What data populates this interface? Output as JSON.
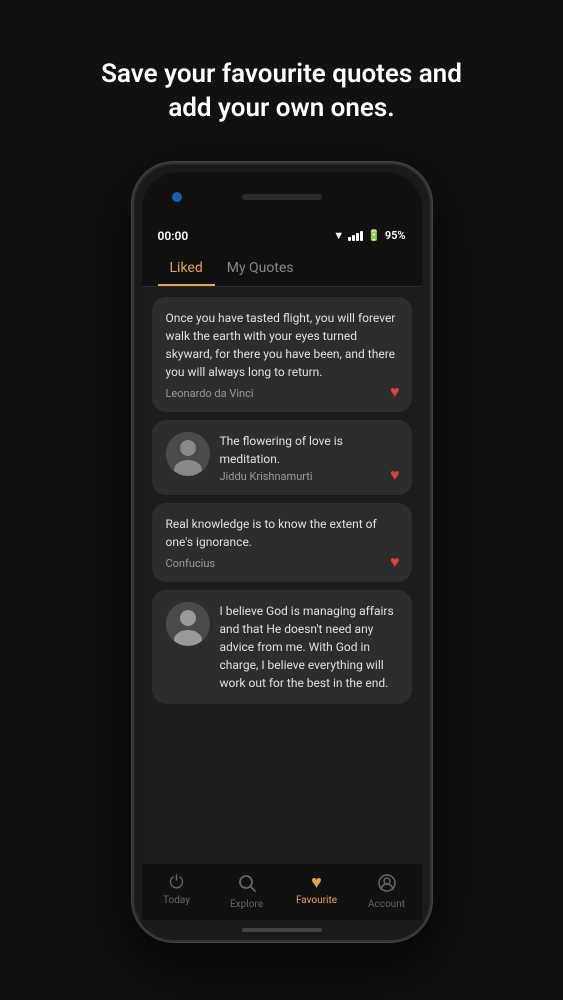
{
  "header": {
    "title": "Save your favourite quotes and add your own ones."
  },
  "status_bar": {
    "time": "00:00",
    "battery": "95%"
  },
  "tabs": {
    "items": [
      {
        "label": "Liked",
        "active": true
      },
      {
        "label": "My Quotes",
        "active": false
      }
    ]
  },
  "quotes": [
    {
      "id": 1,
      "text": "Once you have tasted flight, you will forever walk the earth with your eyes turned skyward, for there you have been, and there you will always long to return.",
      "author": "Leonardo da Vinci",
      "has_avatar": false,
      "liked": true
    },
    {
      "id": 2,
      "text": "The flowering of love is meditation.",
      "author": "Jiddu Krishnamurti",
      "has_avatar": true,
      "liked": true
    },
    {
      "id": 3,
      "text": "Real knowledge is to know the extent of one's ignorance.",
      "author": "Confucius",
      "has_avatar": false,
      "liked": true
    },
    {
      "id": 4,
      "text": "I believe God is managing affairs and that He doesn't need any advice from me. With God in charge, I believe everything will work out for the best in the end.",
      "author": "",
      "has_avatar": true,
      "liked": false
    }
  ],
  "bottom_nav": {
    "items": [
      {
        "label": "Today",
        "icon": "⏻",
        "active": false
      },
      {
        "label": "Explore",
        "icon": "🔍",
        "active": false
      },
      {
        "label": "Favourite",
        "icon": "♥",
        "active": true
      },
      {
        "label": "Account",
        "icon": "☺",
        "active": false
      }
    ]
  }
}
